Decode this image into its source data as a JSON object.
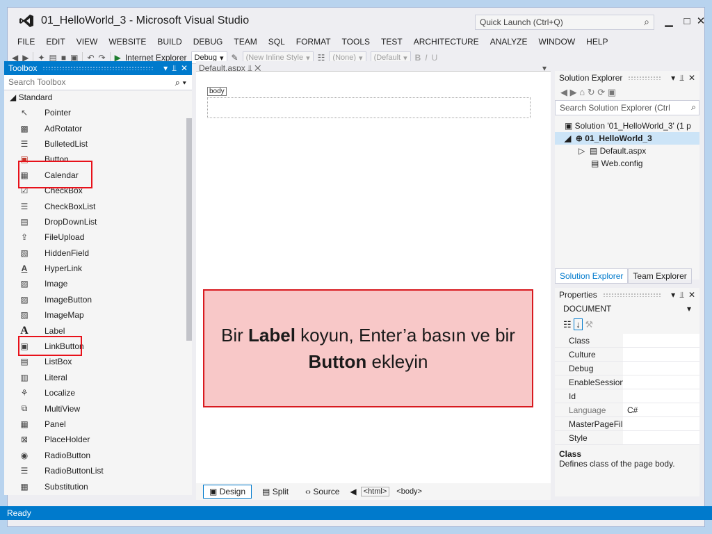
{
  "titlebar": {
    "title": "01_HelloWorld_3 - Microsoft Visual Studio",
    "quick_launch_placeholder": "Quick Launch (Ctrl+Q)"
  },
  "menu": [
    "FILE",
    "EDIT",
    "VIEW",
    "WEBSITE",
    "BUILD",
    "DEBUG",
    "TEAM",
    "SQL",
    "FORMAT",
    "TOOLS",
    "TEST",
    "ARCHITECTURE",
    "ANALYZE",
    "WINDOW",
    "HELP"
  ],
  "toolbar": {
    "run_label": "Internet Explorer",
    "config": "Debug",
    "style_combo": "(New Inline Style",
    "none_combo": "(None)",
    "default_combo": "(Default"
  },
  "toolbox": {
    "title": "Toolbox",
    "search_placeholder": "Search Toolbox",
    "category": "Standard",
    "items": [
      "Pointer",
      "AdRotator",
      "BulletedList",
      "Button",
      "Calendar",
      "CheckBox",
      "CheckBoxList",
      "DropDownList",
      "FileUpload",
      "HiddenField",
      "HyperLink",
      "Image",
      "ImageButton",
      "ImageMap",
      "Label",
      "LinkButton",
      "ListBox",
      "Literal",
      "Localize",
      "MultiView",
      "Panel",
      "PlaceHolder",
      "RadioButton",
      "RadioButtonList",
      "Substitution"
    ]
  },
  "editor": {
    "tab": "Default.aspx",
    "body_tag": "body",
    "view_buttons": [
      "Design",
      "Split",
      "Source"
    ],
    "crumbs": [
      "<html>",
      "<body>"
    ]
  },
  "callout": {
    "part1": "Bir ",
    "bold1": "Label",
    "part2": " koyun, Enter’a basın ve bir ",
    "bold2": "Button",
    "part3": " ekleyin"
  },
  "solution": {
    "title": "Solution Explorer",
    "search_placeholder": "Search Solution Explorer (Ctrl",
    "solution_item": "Solution '01_HelloWorld_3' (1 p",
    "project": "01_HelloWorld_3",
    "files": [
      "Default.aspx",
      "Web.config"
    ],
    "tabs": [
      "Solution Explorer",
      "Team Explorer"
    ]
  },
  "properties": {
    "title": "Properties",
    "object": "DOCUMENT",
    "rows": [
      {
        "name": "Class",
        "value": ""
      },
      {
        "name": "Culture",
        "value": ""
      },
      {
        "name": "Debug",
        "value": ""
      },
      {
        "name": "EnableSession",
        "value": ""
      },
      {
        "name": "Id",
        "value": ""
      },
      {
        "name": "Language",
        "value": "C#"
      },
      {
        "name": "MasterPageFil",
        "value": ""
      },
      {
        "name": "Style",
        "value": ""
      }
    ],
    "desc_title": "Class",
    "desc_text": "Defines class of the page body."
  },
  "status": "Ready",
  "colors": {
    "accent": "#007acc",
    "highlight": "#e8111a"
  }
}
